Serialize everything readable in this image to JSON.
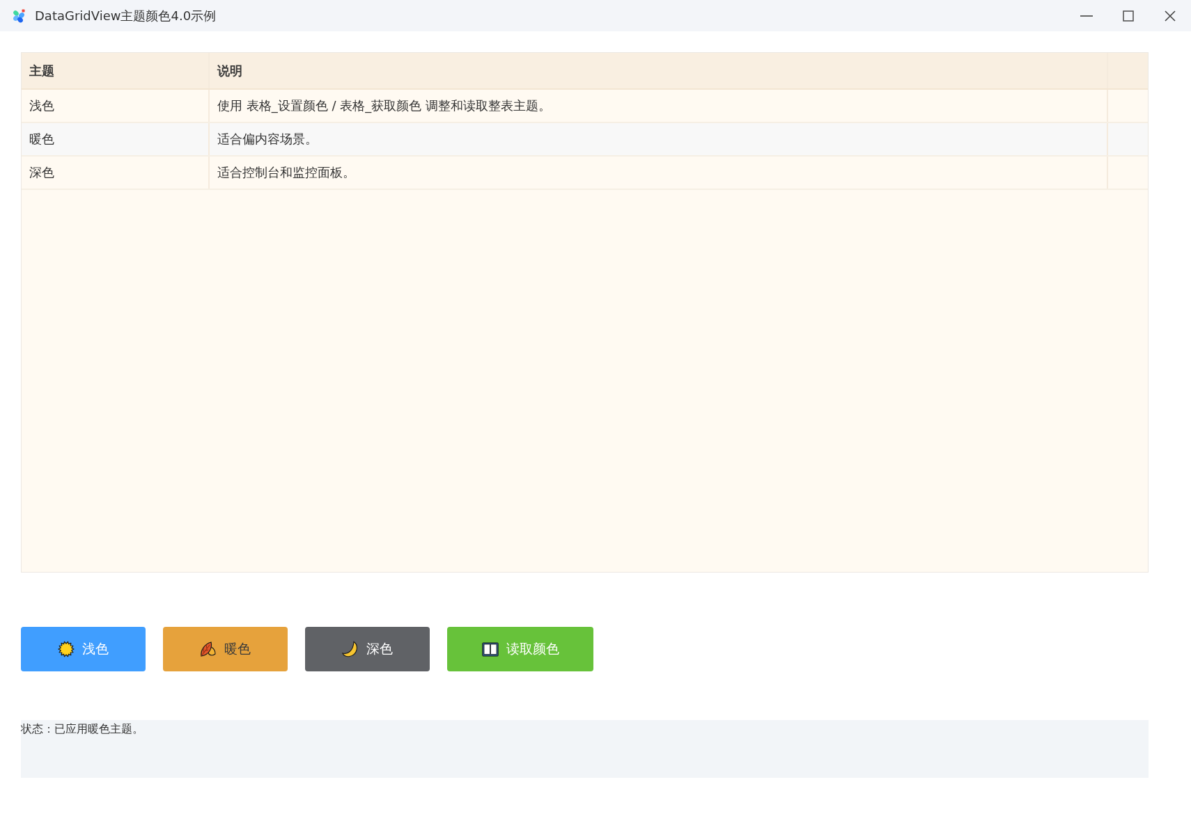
{
  "window": {
    "title": "DataGridView主题颜色4.0示例"
  },
  "table": {
    "columns": [
      "主题",
      "说明"
    ],
    "rows": [
      {
        "cells": [
          "浅色",
          "使用 表格_设置颜色 / 表格_获取颜色 调整和读取整表主题。"
        ]
      },
      {
        "cells": [
          "暖色",
          "适合偏内容场景。"
        ]
      },
      {
        "cells": [
          "深色",
          "适合控制台和监控面板。"
        ]
      }
    ]
  },
  "buttons": [
    {
      "label": "浅色",
      "kind": "light",
      "color": "#409eff"
    },
    {
      "label": "暖色",
      "kind": "warm",
      "color": "#e6a23c"
    },
    {
      "label": "深色",
      "kind": "dark",
      "color": "#606266"
    },
    {
      "label": "读取颜色",
      "kind": "read",
      "color": "#67c23a"
    }
  ],
  "status_bar": {
    "text": "状态：已应用暖色主题。"
  }
}
